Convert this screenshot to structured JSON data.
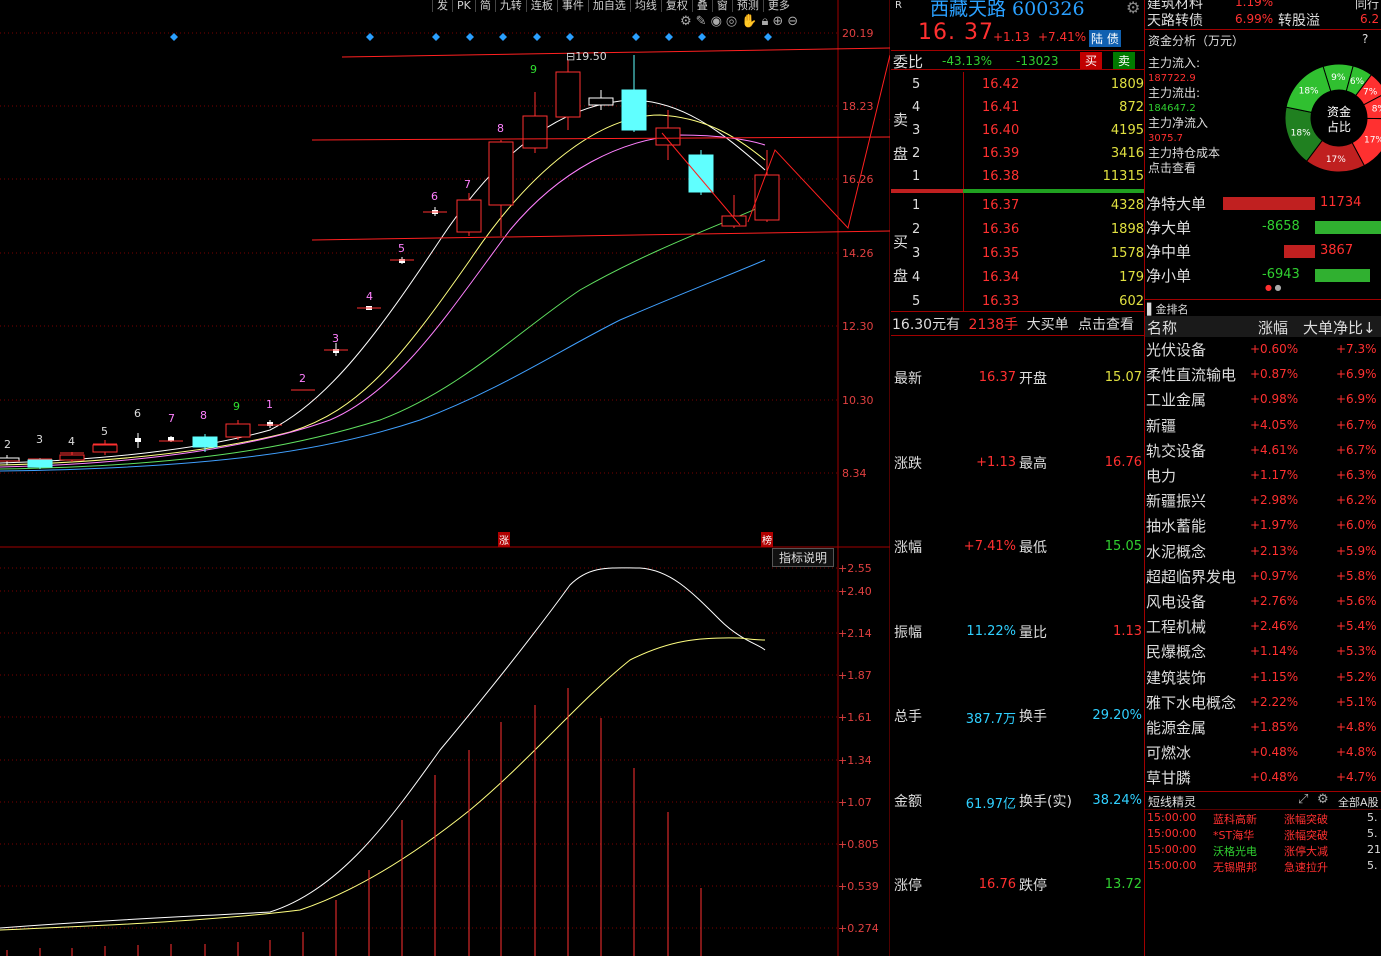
{
  "toolbar": {
    "items": [
      "发",
      "PK",
      "简",
      "九转",
      "连板",
      "事件",
      "加自选",
      "均线",
      "复权",
      "叠",
      "窗",
      "预测",
      "更多"
    ]
  },
  "toolbar_icons": [
    "settings-icon",
    "pen-icon",
    "eye-icon",
    "eye-alt-icon",
    "hand-icon",
    "lock-icon",
    "zoom-in-icon",
    "zoom-out-icon"
  ],
  "main_chart": {
    "y_labels": [
      "20.19",
      "18.23",
      "16.26",
      "14.26",
      "12.30",
      "10.30",
      "8.34"
    ],
    "high_label": "19.50",
    "markers": {
      "zhang": "涨",
      "bang": "榜"
    },
    "td_counts_bottom": [
      "2",
      "3",
      "4",
      "5",
      "6",
      "7",
      "8",
      "9",
      "1"
    ],
    "td_counts_top": [
      "2",
      "3",
      "4",
      "5",
      "6",
      "7",
      "8",
      "9"
    ]
  },
  "indicator": {
    "button": "指标说明",
    "y_labels": [
      "2.55",
      "2.40",
      "2.14",
      "1.87",
      "1.61",
      "1.34",
      "1.07",
      "0.805",
      "0.539",
      "0.274"
    ]
  },
  "stock": {
    "r_mark": "R",
    "name_code": "西藏天路 600326",
    "price": "16. 37",
    "change": "+1.13",
    "change_pct": "+7.41%",
    "tag": "陆 债"
  },
  "top_right": {
    "line1_name": "建筑材料",
    "line1_pct": "1.19%",
    "line1_right": "同行",
    "line2_name": "天路转债",
    "line2_pct": "6.99%",
    "line2_mid": "转股溢",
    "line2_right": "6.2"
  },
  "weibi": {
    "label": "委比",
    "pct": "-43.13%",
    "diff": "-13023",
    "buy": "买",
    "sell": "卖"
  },
  "orderbook": {
    "sell_label": "卖盘",
    "buy_label": "买盘",
    "sells": [
      {
        "lv": "5",
        "price": "16.42",
        "vol": "1809"
      },
      {
        "lv": "4",
        "price": "16.41",
        "vol": "872"
      },
      {
        "lv": "3",
        "price": "16.40",
        "vol": "4195"
      },
      {
        "lv": "2",
        "price": "16.39",
        "vol": "3416"
      },
      {
        "lv": "1",
        "price": "16.38",
        "vol": "11315"
      }
    ],
    "buys": [
      {
        "lv": "1",
        "price": "16.37",
        "vol": "4328"
      },
      {
        "lv": "2",
        "price": "16.36",
        "vol": "1898"
      },
      {
        "lv": "3",
        "price": "16.35",
        "vol": "1578"
      },
      {
        "lv": "4",
        "price": "16.34",
        "vol": "179"
      },
      {
        "lv": "5",
        "price": "16.33",
        "vol": "602"
      }
    ],
    "bigorder": {
      "price": "16.30元有",
      "qty": "2138手",
      "label": "大买单",
      "link": "点击查看"
    }
  },
  "stats": [
    {
      "l1": "最新",
      "v1": "16.37",
      "l2": "开盘",
      "v2": "15.07"
    },
    {
      "l1": "涨跌",
      "v1": "+1.13",
      "l2": "最高",
      "v2": "16.76"
    },
    {
      "l1": "涨幅",
      "v1": "+7.41%",
      "l2": "最低",
      "v2": "15.05"
    },
    {
      "l1": "振幅",
      "v1": "11.22%",
      "l2": "量比",
      "v2": "1.13"
    },
    {
      "l1": "总手",
      "v1": "387.7万",
      "l2": "换手",
      "v2": "29.20%"
    },
    {
      "l1": "金额",
      "v1": "61.97亿",
      "l2": "换手(实)",
      "v2": "38.24%"
    },
    {
      "l1": "涨停",
      "v1": "16.76",
      "l2": "跌停",
      "v2": "13.72"
    }
  ],
  "funds": {
    "title": "资金分析（万元）",
    "help": "?",
    "inflow_label": "主力流入:",
    "inflow": "187722.9",
    "outflow_label": "主力流出:",
    "outflow": "184647.2",
    "net_label": "主力净流入",
    "net": "3075.7",
    "cost_label": "主力持仓成本",
    "cost_link": "点击查看",
    "donut_center": [
      "资金",
      "占比"
    ],
    "donut_labels": [
      "9%",
      "6%",
      "7%",
      "8%",
      "17%",
      "17%",
      "18%",
      "18%"
    ]
  },
  "flows": [
    {
      "label": "净特大单",
      "value": "11734",
      "dir": "in",
      "frac": 0.78
    },
    {
      "label": "净大单",
      "value": "-8658",
      "dir": "out",
      "frac": 0.58
    },
    {
      "label": "净中单",
      "value": "3867",
      "dir": "in",
      "frac": 0.26
    },
    {
      "label": "净小单",
      "value": "-6943",
      "dir": "out",
      "frac": 0.47
    }
  ],
  "sector": {
    "title": "金排名",
    "headers": [
      "名称",
      "涨幅",
      "大单净比↓"
    ],
    "rows": [
      {
        "name": "光伏设备",
        "zf": "+0.60%",
        "dd": "+7.3%"
      },
      {
        "name": "柔性直流输电",
        "zf": "+0.87%",
        "dd": "+6.9%"
      },
      {
        "name": "工业金属",
        "zf": "+0.98%",
        "dd": "+6.9%"
      },
      {
        "name": "新疆",
        "zf": "+4.05%",
        "dd": "+6.7%"
      },
      {
        "name": "轨交设备",
        "zf": "+4.61%",
        "dd": "+6.7%"
      },
      {
        "name": "电力",
        "zf": "+1.17%",
        "dd": "+6.3%"
      },
      {
        "name": "新疆振兴",
        "zf": "+2.98%",
        "dd": "+6.2%"
      },
      {
        "name": "抽水蓄能",
        "zf": "+1.97%",
        "dd": "+6.0%"
      },
      {
        "name": "水泥概念",
        "zf": "+2.13%",
        "dd": "+5.9%"
      },
      {
        "name": "超超临界发电",
        "zf": "+0.97%",
        "dd": "+5.8%"
      },
      {
        "name": "风电设备",
        "zf": "+2.76%",
        "dd": "+5.6%"
      },
      {
        "name": "工程机械",
        "zf": "+2.46%",
        "dd": "+5.4%"
      },
      {
        "name": "民爆概念",
        "zf": "+1.14%",
        "dd": "+5.3%"
      },
      {
        "name": "建筑装饰",
        "zf": "+1.15%",
        "dd": "+5.2%"
      },
      {
        "name": "雅下水电概念",
        "zf": "+2.22%",
        "dd": "+5.1%"
      },
      {
        "name": "能源金属",
        "zf": "+1.85%",
        "dd": "+4.8%"
      },
      {
        "name": "可燃冰",
        "zf": "+0.48%",
        "dd": "+4.8%"
      },
      {
        "name": "草甘膦",
        "zf": "+0.48%",
        "dd": "+4.7%"
      }
    ]
  },
  "duanxian": {
    "title": "短线精灵",
    "filter": "全部A股",
    "rows": [
      {
        "time": "15:00:00",
        "name": "蓝科高新",
        "event": "涨幅突破",
        "val": "5."
      },
      {
        "time": "15:00:00",
        "name": "*ST海华",
        "event": "涨幅突破",
        "val": "5."
      },
      {
        "time": "15:00:00",
        "name": "沃格光电",
        "event": "涨停大减",
        "val": "21"
      },
      {
        "time": "15:00:00",
        "name": "无锡鼎邦",
        "event": "急速拉升",
        "val": "5."
      }
    ]
  },
  "colors": {
    "up": "#ff3030",
    "down": "#30e0e0",
    "grid": "#8b0000",
    "ma5": "#ffffff",
    "ma10": "#ffff80",
    "ma20": "#ff80ff",
    "ma30": "#60e060",
    "ma60": "#40a0ff"
  }
}
